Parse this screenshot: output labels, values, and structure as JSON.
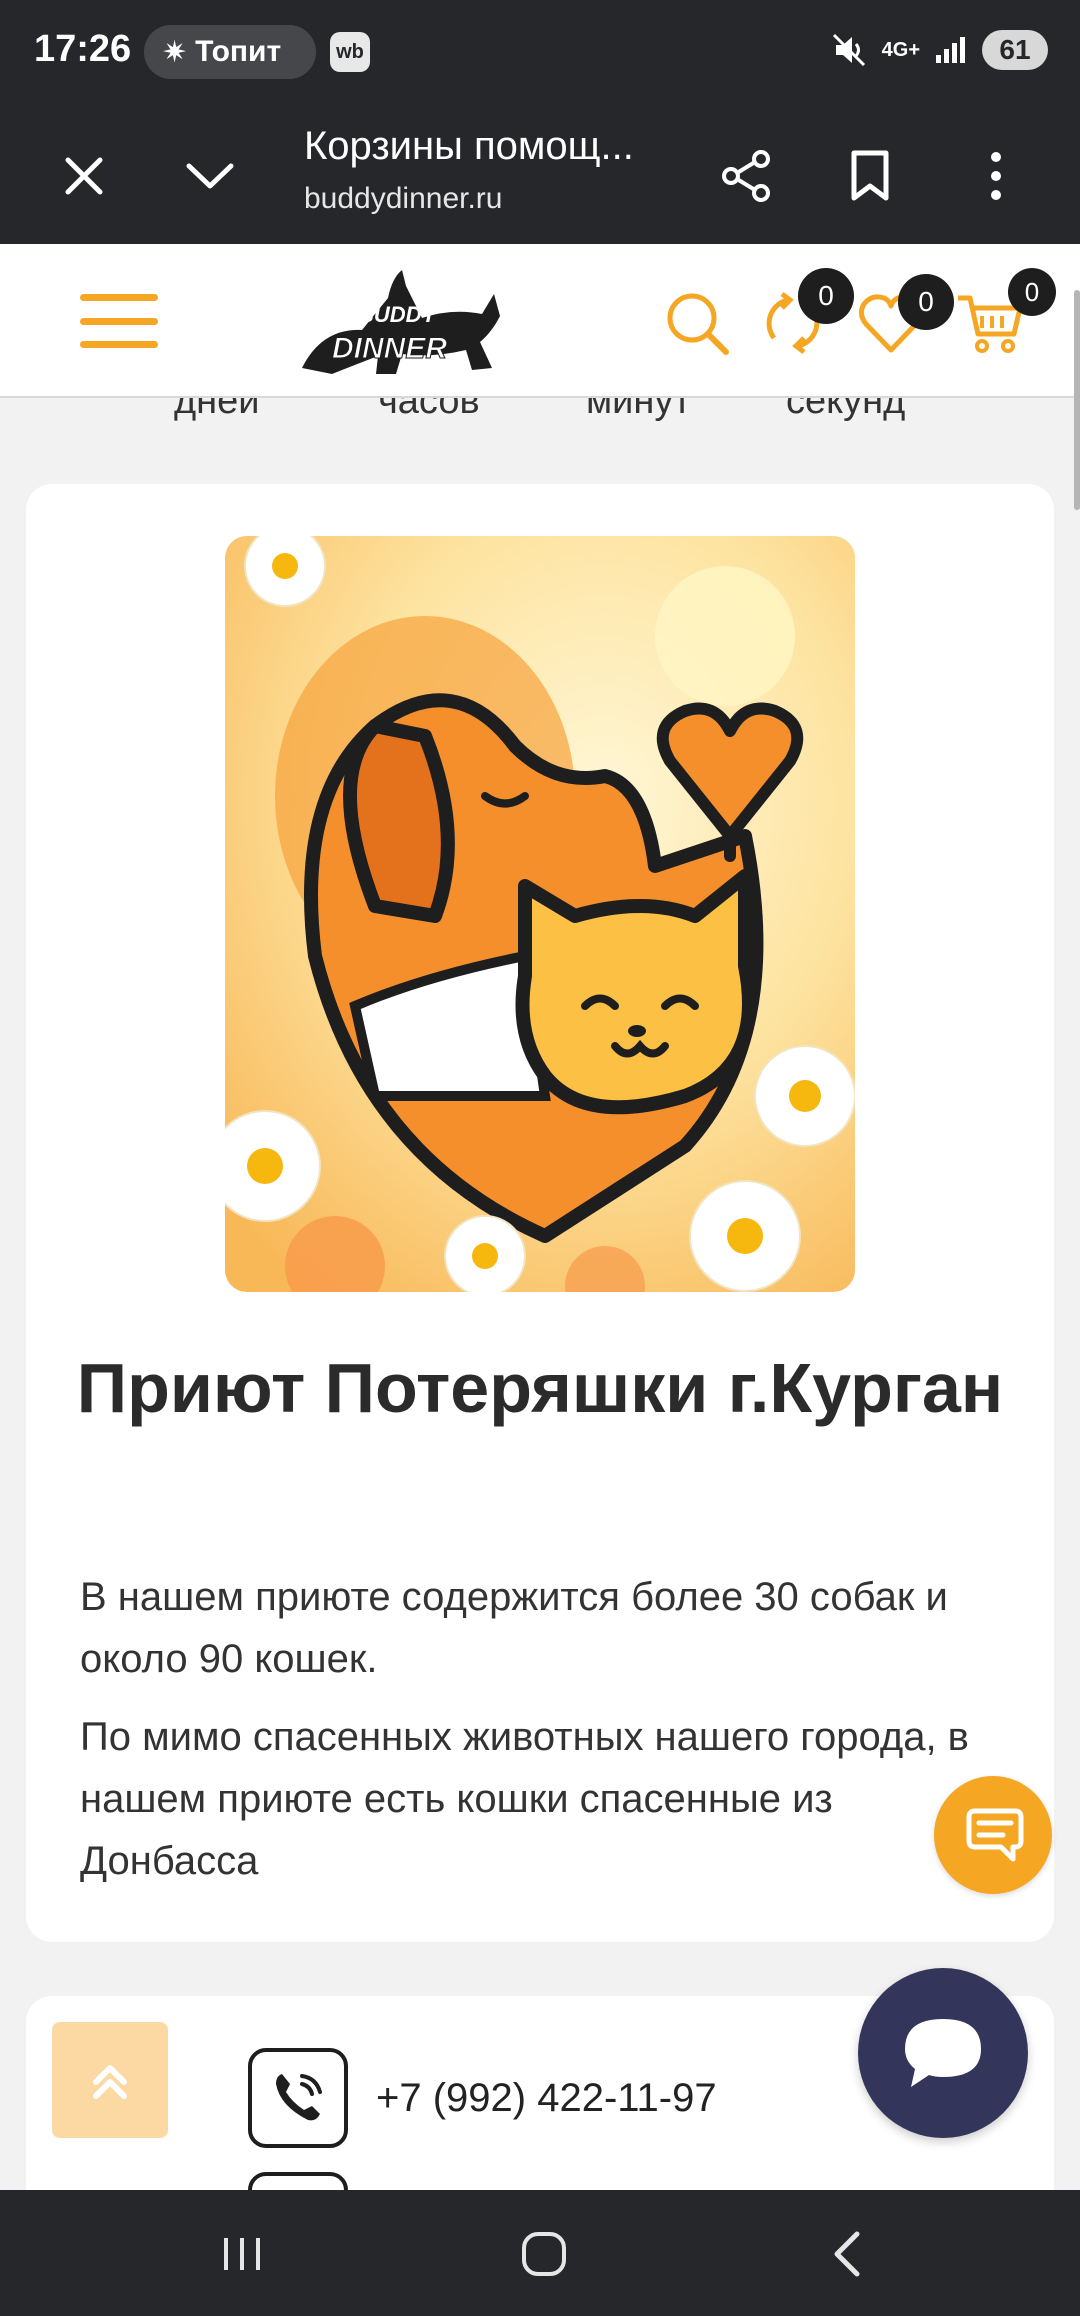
{
  "status_bar": {
    "time": "17:26",
    "notification_pill": "Топит",
    "app_badge": "wb",
    "network": "4G+",
    "battery": "61"
  },
  "browser": {
    "page_title": "Корзины помощ...",
    "url": "buddydinner.ru"
  },
  "site_header": {
    "logo_text_top": "BUDDY",
    "logo_text_bottom": "DINNER",
    "compare_count": "0",
    "favorites_count": "0",
    "cart_count": "0",
    "accent_color": "#f5a623"
  },
  "countdown": {
    "days_label": "дней",
    "hours_label": "часов",
    "minutes_label": "минут",
    "seconds_label": "секунд"
  },
  "shelter": {
    "title": "Приют Потеряшки г.Курган",
    "paragraph1": "В нашем приюте содержится более 30 собак и около 90 кошек.",
    "paragraph2": "По мимо спасенных животных нашего города, в нашем приюте есть кошки спасенные из Донбасса"
  },
  "contacts": {
    "phone": "+7 (992) 422-11-97"
  },
  "icons": {
    "close": "close-icon",
    "chevron": "chevron-down-icon",
    "share": "share-icon",
    "bookmark": "bookmark-icon",
    "menu": "more-vert-icon",
    "search": "search-icon",
    "compare": "compare-icon",
    "heart": "heart-icon",
    "cart": "cart-icon"
  }
}
